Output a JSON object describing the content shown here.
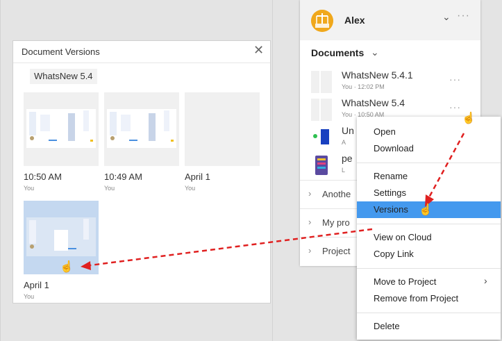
{
  "account": {
    "name": "Alex",
    "chevron_icon": "chevron-down-icon",
    "more_icon": "more-icon"
  },
  "documents": {
    "title": "Documents",
    "items": [
      {
        "name": "WhatsNew 5.4.1",
        "meta": "You · 12:02 PM"
      },
      {
        "name": "WhatsNew 5.4",
        "meta": "You · 10:50 AM"
      },
      {
        "name": "Un",
        "meta": "A"
      },
      {
        "name": "pe",
        "meta": "L"
      }
    ]
  },
  "sections": [
    {
      "label": "Anothe"
    },
    {
      "label": "My pro"
    },
    {
      "label": "Project"
    }
  ],
  "versions_panel": {
    "title": "Document Versions",
    "close_icon": "close-icon",
    "doc_name": "WhatsNew 5.4",
    "versions": [
      {
        "time": "10:50 AM",
        "user": "You"
      },
      {
        "time": "10:49 AM",
        "user": "You"
      },
      {
        "time": "April 1",
        "user": "You"
      },
      {
        "time": "April 1",
        "user": "You"
      }
    ]
  },
  "context_menu": {
    "items": [
      "Open",
      "Download",
      "Rename",
      "Settings",
      "Versions",
      "View on Cloud",
      "Copy Link",
      "Move to Project",
      "Remove from Project",
      "Delete"
    ],
    "selected": "Versions",
    "submenu_icon": "chevron-right-icon"
  },
  "annotation_color": "#e02020",
  "selection_color": "#4499ee"
}
